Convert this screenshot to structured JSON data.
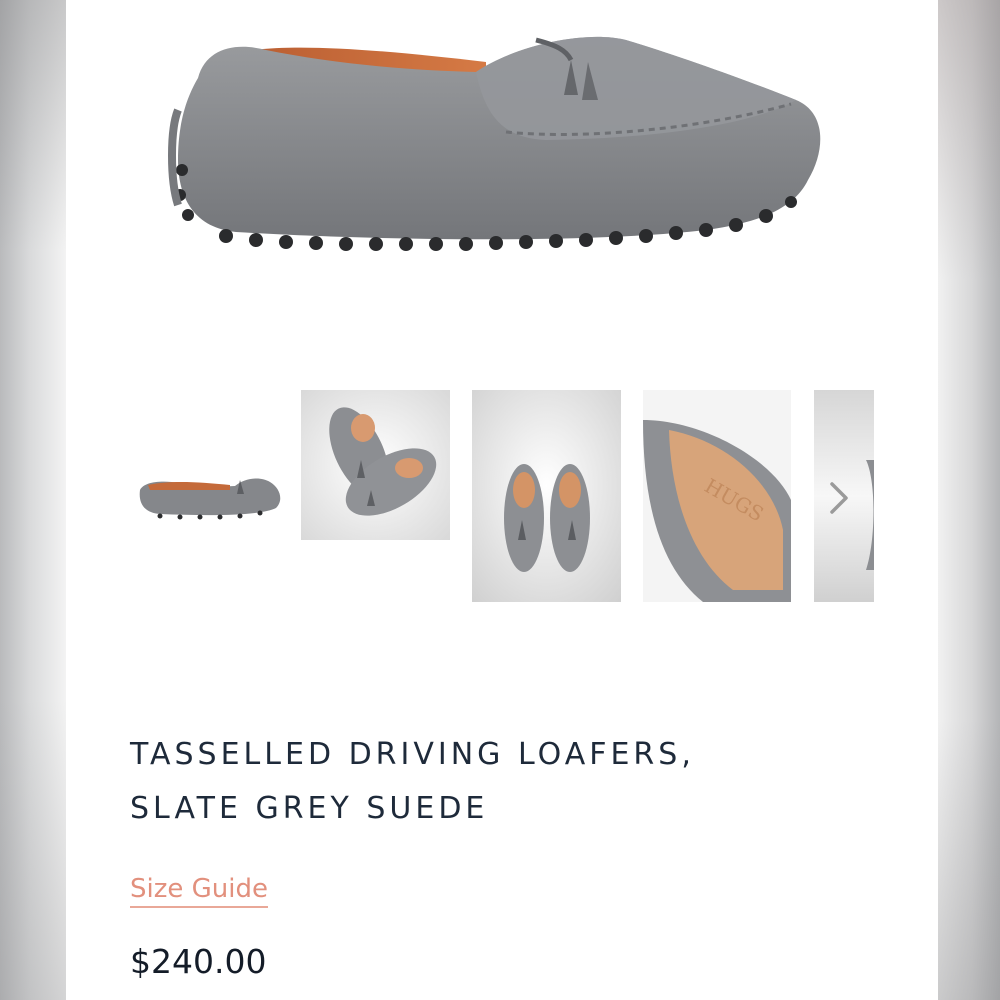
{
  "product": {
    "title_line1": "TASSELLED DRIVING LOAFERS,",
    "title_line2": "SLATE GREY SUEDE",
    "size_guide_label": "Size Guide",
    "price": "$240.00"
  },
  "gallery": {
    "thumbnails": [
      "side view",
      "pair angled",
      "pair top view",
      "insole close-up",
      "partial next image"
    ],
    "next_icon": "chevron-right-icon"
  },
  "colors": {
    "suede": "#8a8c90",
    "lining": "#c8673a",
    "title_text": "#1e2a3a",
    "accent_link": "#e2907d"
  }
}
